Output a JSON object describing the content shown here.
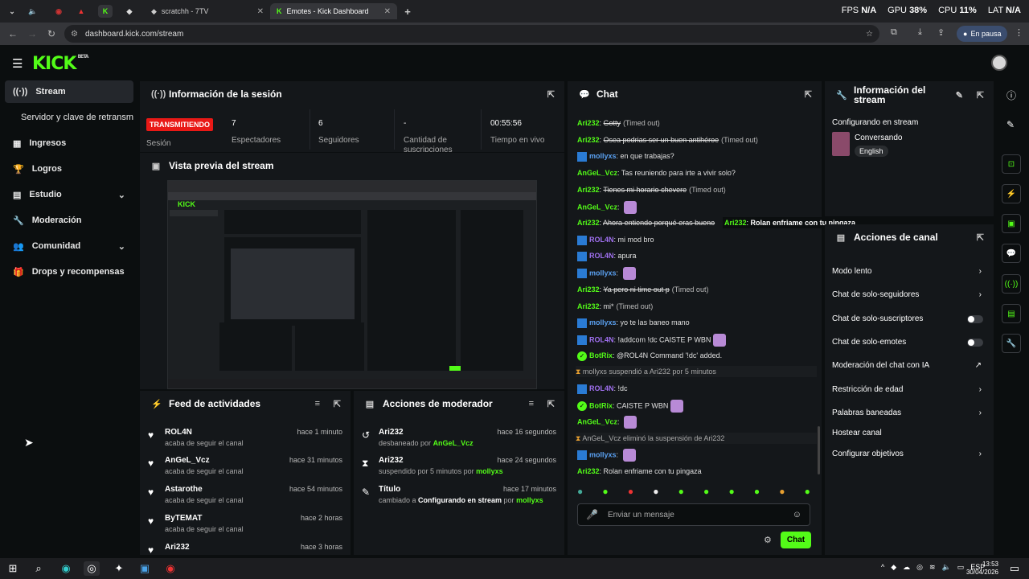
{
  "browser": {
    "tabs": [
      {
        "title": "scratchh - 7TV"
      },
      {
        "title": "Emotes - Kick Dashboard"
      }
    ],
    "new_tab": "+",
    "url": "dashboard.kick.com/stream",
    "pause_label": "En pausa",
    "perf": {
      "fps_label": "FPS",
      "fps": "N/A",
      "gpu_label": "GPU",
      "gpu": "38%",
      "cpu_label": "CPU",
      "cpu": "11%",
      "lat_label": "LAT",
      "lat": "N/A"
    }
  },
  "kick": {
    "logo": "KICK",
    "logo_sup": "BETA"
  },
  "nav": {
    "items": [
      {
        "label": "Stream"
      },
      {
        "label": "Servidor y clave de retransm"
      },
      {
        "label": "Ingresos"
      },
      {
        "label": "Logros"
      },
      {
        "label": "Estudio"
      },
      {
        "label": "Moderación"
      },
      {
        "label": "Comunidad"
      },
      {
        "label": "Drops y recompensas"
      }
    ]
  },
  "session": {
    "title": "Información de la sesión",
    "status": "TRANSMITIENDO",
    "status_label": "Sesión",
    "viewers": "7",
    "viewers_label": "Espectadores",
    "followers": "6",
    "followers_label": "Seguidores",
    "subs": "-",
    "subs_label": "Cantidad de suscripciones",
    "time": "00:55:56",
    "time_label": "Tiempo en vivo"
  },
  "preview": {
    "title": "Vista previa del stream"
  },
  "feed": {
    "title": "Feed de actividades",
    "items": [
      {
        "name": "ROL4N",
        "desc": "acaba de seguir el canal",
        "time": "hace 1 minuto"
      },
      {
        "name": "AnGeL_Vcz",
        "desc": "acaba de seguir el canal",
        "time": "hace 31 minutos"
      },
      {
        "name": "Astarothe",
        "desc": "acaba de seguir el canal",
        "time": "hace 54 minutos"
      },
      {
        "name": "ByTEMAT",
        "desc": "acaba de seguir el canal",
        "time": "hace 2 horas"
      },
      {
        "name": "Ari232",
        "desc": "",
        "time": "hace 3 horas"
      }
    ]
  },
  "modactions": {
    "title": "Acciones de moderador",
    "items": [
      {
        "name": "Ari232",
        "desc_pre": "desbaneado por ",
        "desc_user": "AnGeL_Vcz",
        "desc_post": "",
        "time": "hace 16 segundos"
      },
      {
        "name": "Ari232",
        "desc_pre": "suspendido por 5 minutos por ",
        "desc_user": "mollyxs",
        "desc_post": "",
        "time": "hace 24 segundos"
      },
      {
        "name": "Título",
        "desc_pre": "cambiado a ",
        "desc_bold": "Configurando en stream",
        "desc_post": " por ",
        "desc_user": "mollyxs",
        "time": "hace 17 minutos"
      }
    ]
  },
  "chat": {
    "title": "Chat",
    "input_placeholder": "Enviar un mensaje",
    "send_label": "Chat",
    "lines": [
      {
        "user": "Ari232",
        "color": "#53fc18",
        "msg": "Gotty",
        "tag": "(Timed out)",
        "strike": true
      },
      {
        "user": "Ari232",
        "color": "#53fc18",
        "msg": "Osea podrias ser un buen antihéroe",
        "tag": "(Timed out)",
        "strike": true
      },
      {
        "user": "mollyxs",
        "color": "#5aa0f0",
        "msg": "en que trabajas?",
        "tag": ""
      },
      {
        "user": "AnGeL_Vcz",
        "color": "#53fc18",
        "msg": "Tas reuniendo para irte a vivir solo?",
        "tag": ""
      },
      {
        "user": "Ari232",
        "color": "#53fc18",
        "msg": "Tienes mi horario chevere",
        "tag": "(Timed out)",
        "strike": true
      },
      {
        "user": "AnGeL_Vcz",
        "color": "#53fc18",
        "msg": "",
        "tag": "",
        "emote": true
      },
      {
        "user": "Ari232",
        "color": "#53fc18",
        "msg": "Ahora entiendo porqué eras bueno",
        "tag": "",
        "strike": true
      },
      {
        "user": "ROL4N",
        "color": "#a070f0",
        "msg": "mi mod bro",
        "tag": ""
      },
      {
        "user": "ROL4N",
        "color": "#a070f0",
        "msg": "apura",
        "tag": ""
      },
      {
        "user": "mollyxs",
        "color": "#5aa0f0",
        "msg": "",
        "tag": "",
        "emote": true
      },
      {
        "user": "Ari232",
        "color": "#53fc18",
        "msg": "Ya pero ni time out p",
        "tag": "(Timed out)",
        "strike": true
      },
      {
        "user": "Ari232",
        "color": "#53fc18",
        "msg": "mi*",
        "tag": "(Timed out)"
      },
      {
        "user": "mollyxs",
        "color": "#5aa0f0",
        "msg": "yo te las baneo mano",
        "tag": ""
      },
      {
        "user": "ROL4N",
        "color": "#a070f0",
        "msg": "!addcom !dc CAISTE P WBN",
        "tag": "",
        "emote": true
      },
      {
        "user": "BotRix",
        "color": "#53fc18",
        "msg": "@ROL4N Command '!dc' added.",
        "tag": ""
      },
      {
        "system": "mollyxs suspendió a Ari232 por 5 minutos"
      },
      {
        "user": "ROL4N",
        "color": "#a070f0",
        "msg": "!dc",
        "tag": ""
      },
      {
        "user": "BotRix",
        "color": "#53fc18",
        "msg": "CAISTE P WBN",
        "tag": "",
        "emote": true
      },
      {
        "user": "AnGeL_Vcz",
        "color": "#53fc18",
        "msg": "",
        "tag": "",
        "emote": true
      },
      {
        "system": "AnGeL_Vcz eliminó la suspensión de Ari232"
      },
      {
        "user": "mollyxs",
        "color": "#5aa0f0",
        "msg": "",
        "tag": "",
        "emote": true
      },
      {
        "user": "Ari232",
        "color": "#53fc18",
        "msg": "Rolan enfriame con tu pingaza",
        "tag": ""
      }
    ],
    "tooltip": {
      "user": "Ari232",
      "msg": "Rolan enfriame con tu pingaza"
    }
  },
  "stream_info": {
    "title": "Información del stream",
    "stream_title": "Configurando en stream",
    "category": "Conversando",
    "language": "English"
  },
  "channel_actions": {
    "title": "Acciones de canal",
    "items": [
      {
        "label": "Modo lento",
        "kind": "arrow"
      },
      {
        "label": "Chat de solo-seguidores",
        "kind": "arrow"
      },
      {
        "label": "Chat de solo-suscriptores",
        "kind": "toggle"
      },
      {
        "label": "Chat de solo-emotes",
        "kind": "toggle"
      },
      {
        "label": "Moderación del chat con IA",
        "kind": "ext"
      },
      {
        "label": "Restricción de edad",
        "kind": "arrow"
      },
      {
        "label": "Palabras baneadas",
        "kind": "arrow"
      },
      {
        "label": "Hostear canal",
        "kind": "none"
      },
      {
        "label": "Configurar objetivos",
        "kind": "arrow"
      }
    ]
  },
  "taskbar": {
    "time": "13:53",
    "date": "30/04/2026",
    "lang": "ESP"
  },
  "colors": {
    "accent": "#53fc18",
    "live": "#e91916",
    "panel": "#14171a",
    "bg": "#0b0e0f"
  }
}
